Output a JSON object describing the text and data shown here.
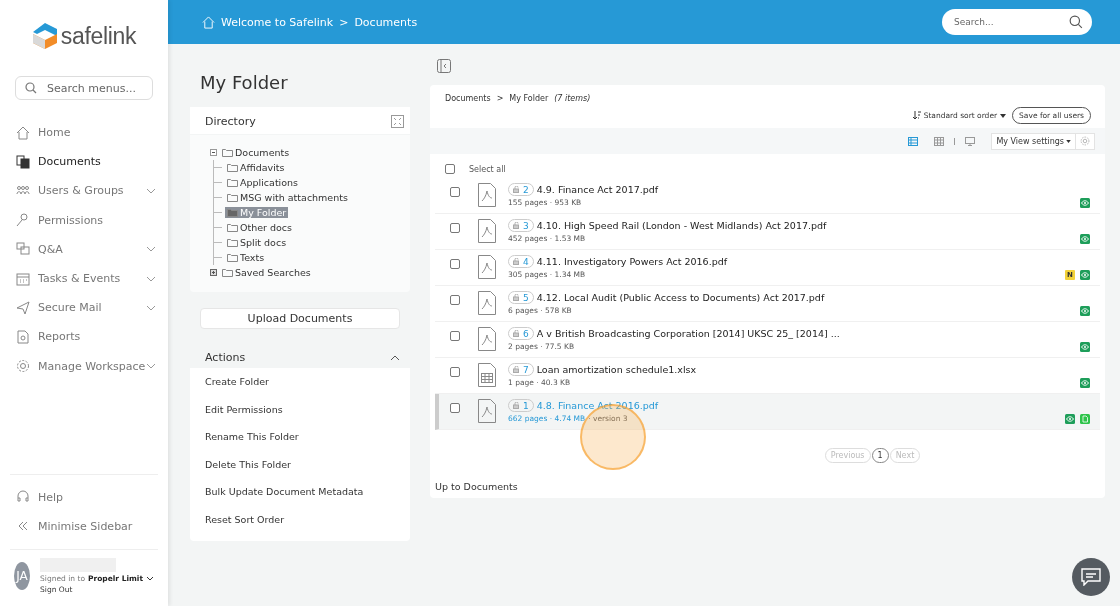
{
  "logo": {
    "text": "safelink"
  },
  "sidebar": {
    "search": {
      "placeholder": "Search menus..."
    },
    "items": [
      {
        "label": "Home",
        "selected": false,
        "expandable": false
      },
      {
        "label": "Documents",
        "selected": true,
        "expandable": false
      },
      {
        "label": "Users & Groups",
        "selected": false,
        "expandable": true
      },
      {
        "label": "Permissions",
        "selected": false,
        "expandable": false
      },
      {
        "label": "Q&A",
        "selected": false,
        "expandable": true
      },
      {
        "label": "Tasks & Events",
        "selected": false,
        "expandable": true
      },
      {
        "label": "Secure Mail",
        "selected": false,
        "expandable": true
      },
      {
        "label": "Reports",
        "selected": false,
        "expandable": false
      },
      {
        "label": "Manage Workspace",
        "selected": false,
        "expandable": true
      }
    ],
    "footer": [
      {
        "label": "Help"
      },
      {
        "label": "Minimise Sidebar"
      }
    ],
    "user": {
      "initials": "JA",
      "signed_in_label": "Signed in to",
      "workspace": "Propelr Limit",
      "sign_out": "Sign Out"
    }
  },
  "topbar": {
    "breadcrumb": [
      "Welcome to Safelink",
      "Documents"
    ],
    "separator": ">",
    "search": {
      "placeholder": "Search..."
    }
  },
  "page_title": "My Folder",
  "directory": {
    "title": "Directory",
    "tree": [
      {
        "label": "Documents",
        "expanded": true,
        "selected": false,
        "children": [
          {
            "label": "Affidavits",
            "selected": false
          },
          {
            "label": "Applications",
            "selected": false
          },
          {
            "label": "MSG with attachments",
            "selected": false
          },
          {
            "label": "My Folder",
            "selected": true
          },
          {
            "label": "Other docs",
            "selected": false
          },
          {
            "label": "Split docs",
            "selected": false
          },
          {
            "label": "Texts",
            "selected": false
          }
        ]
      },
      {
        "label": "Saved Searches",
        "expanded": false,
        "selected": false
      }
    ]
  },
  "upload_button": "Upload Documents",
  "actions": {
    "title": "Actions",
    "expanded": true,
    "items": [
      "Create Folder",
      "Edit Permissions",
      "Rename This Folder",
      "Delete This Folder",
      "Bulk Update Document Metadata",
      "Reset Sort Order"
    ]
  },
  "listing": {
    "breadcrumb": [
      "Documents",
      "My Folder"
    ],
    "separator": ">",
    "count": "(7 items)",
    "sort": "Standard sort order",
    "save_button": "Save for all users",
    "view_settings": "My View settings",
    "select_all": {
      "label": "Select all",
      "checked": false
    },
    "files": [
      {
        "kind": "pdf",
        "number": "2",
        "name": "4.9. Finance Act 2017.pdf",
        "meta": "155 pages · 953 KB",
        "checked": false,
        "selected": false,
        "badges": [
          {
            "kind": "view"
          }
        ]
      },
      {
        "kind": "pdf",
        "number": "3",
        "name": "4.10. High Speed Rail (London - West Midlands) Act 2017.pdf",
        "meta": "452 pages · 1.53 MB",
        "checked": false,
        "selected": false,
        "badges": [
          {
            "kind": "view"
          }
        ]
      },
      {
        "kind": "pdf",
        "number": "4",
        "name": "4.11. Investigatory Powers Act 2016.pdf",
        "meta": "305 pages · 1.34 MB",
        "checked": false,
        "selected": false,
        "badges": [
          {
            "kind": "note",
            "text": "N"
          },
          {
            "kind": "view"
          }
        ]
      },
      {
        "kind": "pdf",
        "number": "5",
        "name": "4.12. Local Audit (Public Access to Documents) Act 2017.pdf",
        "meta": "6 pages · 578 KB",
        "checked": false,
        "selected": false,
        "badges": [
          {
            "kind": "view"
          }
        ]
      },
      {
        "kind": "pdf",
        "number": "6",
        "name": "A v British Broadcasting Corporation [2014] UKSC 25_  [2014] ...",
        "meta": "2 pages · 77.5 KB",
        "checked": false,
        "selected": false,
        "badges": [
          {
            "kind": "view"
          }
        ]
      },
      {
        "kind": "xlsx",
        "number": "7",
        "name": "Loan amortization schedule1.xlsx",
        "meta": "1 page · 40.3 KB",
        "checked": false,
        "selected": false,
        "badges": [
          {
            "kind": "view"
          }
        ]
      },
      {
        "kind": "pdf",
        "number": "1",
        "name": "4.8. Finance Act 2016.pdf",
        "meta": "662 pages · 4.74 MB",
        "version": "· version 3",
        "checked": false,
        "selected": true,
        "badges": [
          {
            "kind": "view"
          },
          {
            "kind": "version"
          }
        ]
      }
    ],
    "pagination": {
      "previous": "Previous",
      "pages": [
        {
          "label": "1",
          "selected": true
        }
      ],
      "next": "Next"
    },
    "up_link": "Up to Documents"
  }
}
